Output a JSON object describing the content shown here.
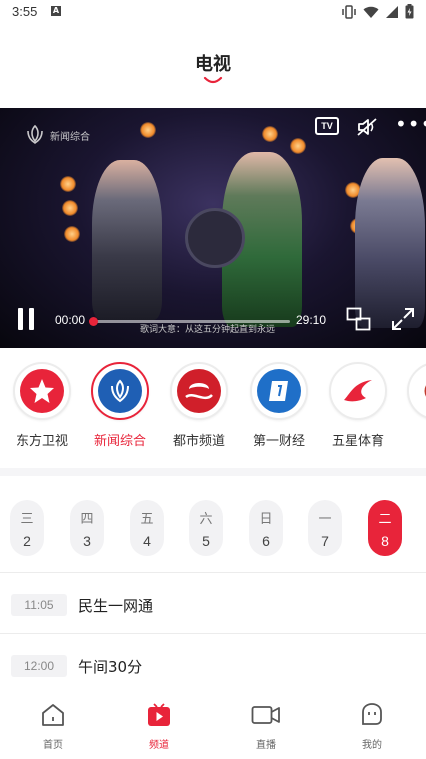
{
  "status_bar": {
    "time": "3:55",
    "notif_badge": "A"
  },
  "header": {
    "title": "电视"
  },
  "player": {
    "channel_watermark": "新闻综合",
    "tv_button_label": "TV",
    "more_label": "•••",
    "subtitle": "歌词大意：从这五分钟起直到永远",
    "current_time": "00:00",
    "total_time": "29:10",
    "progress": 0.0
  },
  "channels": [
    {
      "name": "东方卫视",
      "active": false,
      "icon": "dongfang-star-logo-icon",
      "color": "#e8243a"
    },
    {
      "name": "新闻综合",
      "active": true,
      "icon": "news-tulip-logo-icon",
      "color": "#1f5fb4"
    },
    {
      "name": "都市频道",
      "active": false,
      "icon": "metro-channel-logo-icon",
      "color": "#d01f2a"
    },
    {
      "name": "第一财经",
      "active": false,
      "icon": "finance-logo-icon",
      "color": "#1f6fc8"
    },
    {
      "name": "五星体育",
      "active": false,
      "icon": "sports-swoosh-logo-icon",
      "color": "#e8243a"
    },
    {
      "name": "",
      "active": false,
      "icon": "partial-channel-logo-icon",
      "color": "#c0392b"
    }
  ],
  "days": [
    {
      "weekday": "三",
      "date": "2",
      "active": false
    },
    {
      "weekday": "四",
      "date": "3",
      "active": false
    },
    {
      "weekday": "五",
      "date": "4",
      "active": false
    },
    {
      "weekday": "六",
      "date": "5",
      "active": false
    },
    {
      "weekday": "日",
      "date": "6",
      "active": false
    },
    {
      "weekday": "一",
      "date": "7",
      "active": false
    },
    {
      "weekday": "二",
      "date": "8",
      "active": true
    }
  ],
  "programs": [
    {
      "time": "11:05",
      "title": "民生一网通"
    },
    {
      "time": "12:00",
      "title": "午间30分"
    }
  ],
  "bottom_nav": [
    {
      "label": "首页",
      "icon": "home-icon",
      "active": false
    },
    {
      "label": "频道",
      "icon": "channel-play-icon",
      "active": true
    },
    {
      "label": "直播",
      "icon": "live-camera-icon",
      "active": false
    },
    {
      "label": "我的",
      "icon": "profile-icon",
      "active": false
    }
  ],
  "colors": {
    "accent": "#e8243a",
    "text": "#222222",
    "muted": "#888888"
  }
}
